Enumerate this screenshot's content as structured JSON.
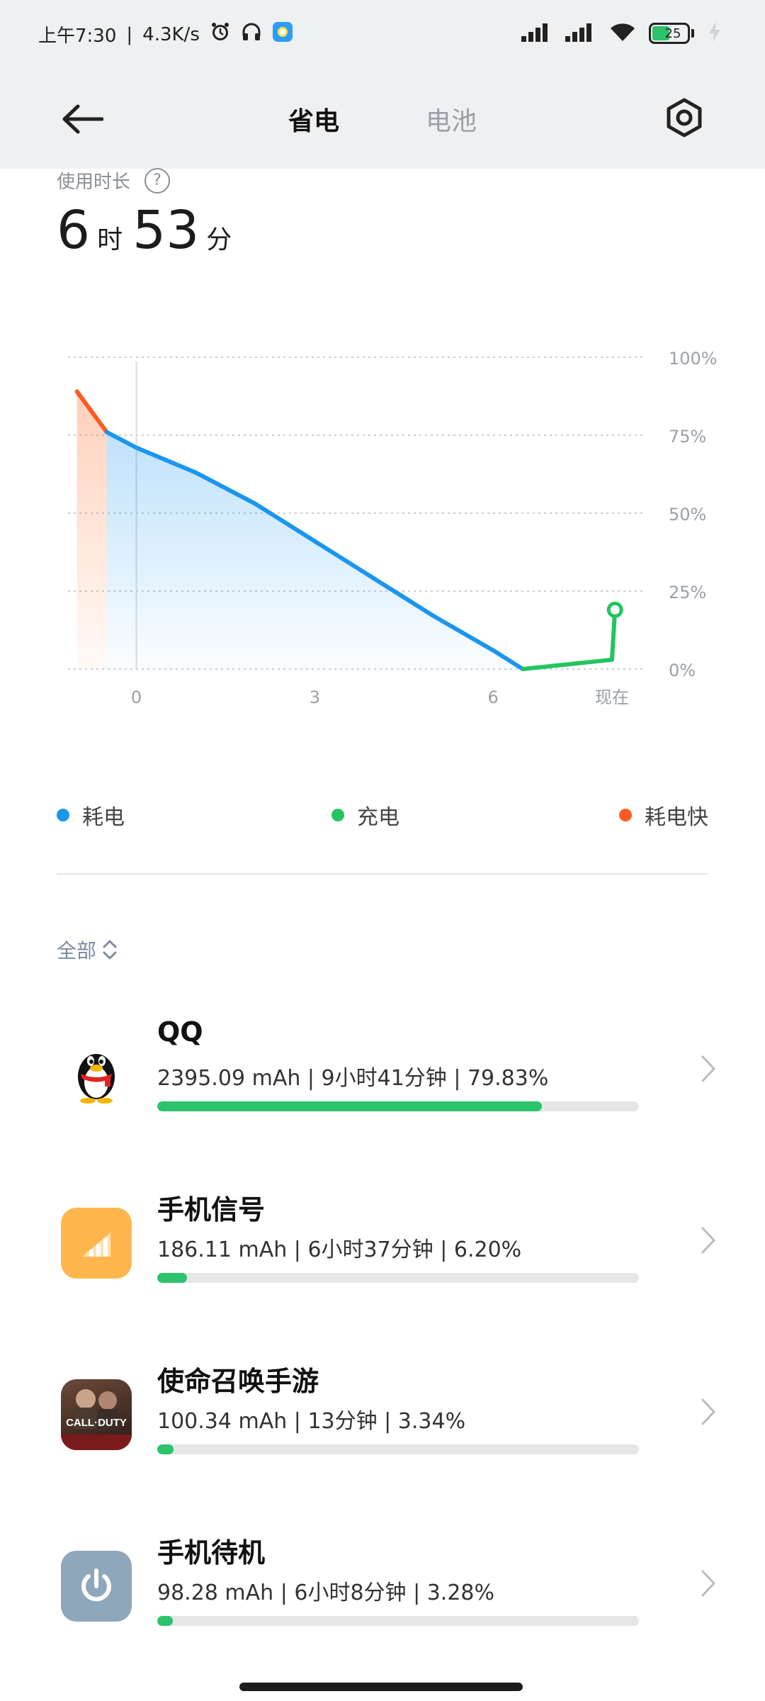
{
  "status_bar": {
    "time": "上午7:30",
    "separator": "|",
    "net_speed": "4.3K/s",
    "battery_level": "25",
    "battery_charging": true,
    "icons": [
      "alarm-icon",
      "headphones-icon",
      "app-notification-icon",
      "signal-icon",
      "signal-icon",
      "wifi-icon",
      "battery-icon",
      "charging-icon"
    ]
  },
  "header": {
    "tabs": [
      {
        "label": "省电",
        "active": true
      },
      {
        "label": "电池",
        "active": false
      }
    ],
    "back_icon": "back-arrow-icon",
    "settings_icon": "settings-icon"
  },
  "usage": {
    "label": "使用时长",
    "hours": "6",
    "hours_unit": "时",
    "minutes": "53",
    "minutes_unit": "分"
  },
  "chart_data": {
    "type": "line",
    "xlabel": "",
    "ylabel": "",
    "x_ticks": [
      "0",
      "3",
      "6",
      "现在"
    ],
    "y_ticks": [
      "100%",
      "75%",
      "50%",
      "25%",
      "0%"
    ],
    "ylim": [
      0,
      100
    ],
    "grid": true,
    "series": [
      {
        "name": "耗电快",
        "color": "#ff5a1f",
        "x": [
          -1,
          -0.5
        ],
        "y": [
          89,
          76
        ]
      },
      {
        "name": "耗电",
        "color": "#1a96f0",
        "x": [
          -0.5,
          0,
          1,
          2,
          3,
          4,
          5,
          6,
          6.5
        ],
        "y": [
          76,
          71,
          63,
          53,
          41,
          29,
          17,
          6,
          0
        ]
      },
      {
        "name": "充电",
        "color": "#22c55e",
        "x": [
          6.5,
          8,
          8.05
        ],
        "y": [
          0,
          3,
          19
        ]
      }
    ]
  },
  "legend": [
    {
      "label": "耗电",
      "color": "#1a96f0"
    },
    {
      "label": "充电",
      "color": "#22c55e"
    },
    {
      "label": "耗电快",
      "color": "#ff5a1f"
    }
  ],
  "filter": {
    "label": "全部"
  },
  "apps": [
    {
      "name": "QQ",
      "stats": "2395.09 mAh | 9小时41分钟 | 79.83%",
      "percent": 79.83,
      "icon": "qq-penguin-icon"
    },
    {
      "name": "手机信号",
      "stats": "186.11 mAh | 6小时37分钟 | 6.20%",
      "percent": 6.2,
      "icon": "signal-bars-icon"
    },
    {
      "name": "使命召唤手游",
      "stats": "100.34 mAh | 13分钟 | 3.34%",
      "percent": 3.34,
      "icon": "call-of-duty-icon",
      "icon_text": "CALL·DUTY"
    },
    {
      "name": "手机待机",
      "stats": "98.28 mAh | 6小时8分钟 | 3.28%",
      "percent": 3.28,
      "icon": "power-icon"
    }
  ]
}
